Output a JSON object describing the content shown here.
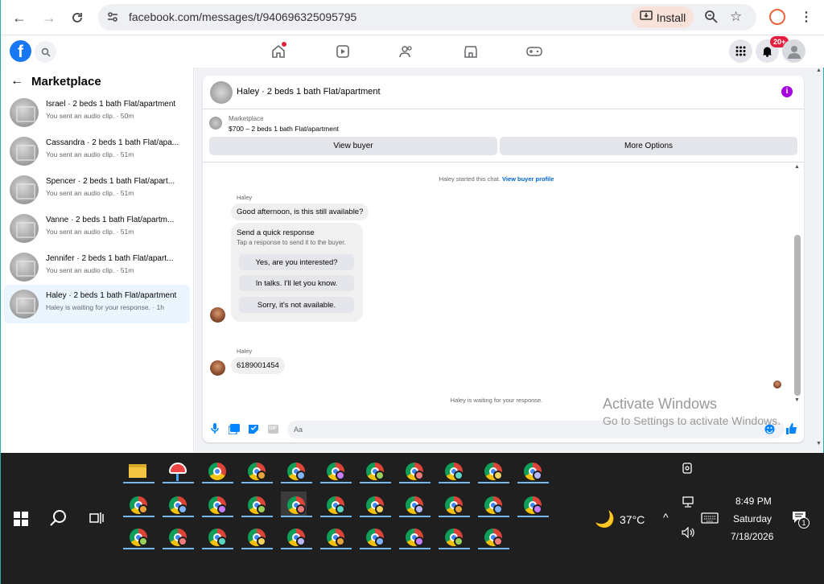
{
  "browser": {
    "url": "facebook.com/messages/t/940696325095795",
    "install_label": "Install"
  },
  "fb": {
    "logo": "f",
    "notification_badge": "20+"
  },
  "sidebar": {
    "title": "Marketplace",
    "conversations": [
      {
        "title": "Israel · 2 beds 1 bath Flat/apartment",
        "sub": "You sent an audio clip. · 50m"
      },
      {
        "title": "Cassandra · 2 beds 1 bath Flat/apa...",
        "sub": "You sent an audio clip. · 51m"
      },
      {
        "title": "Spencer · 2 beds 1 bath Flat/apart...",
        "sub": "You sent an audio clip. · 51m"
      },
      {
        "title": "Vanne · 2 beds 1 bath Flat/apartm...",
        "sub": "You sent an audio clip. · 51m"
      },
      {
        "title": "Jennifer · 2 beds 1 bath Flat/apart...",
        "sub": "You sent an audio clip. · 51m"
      },
      {
        "title": "Haley · 2 beds 1 bath Flat/apartment",
        "sub": "Haley is waiting for your response. · 1h"
      }
    ]
  },
  "chat": {
    "title": "Haley · 2 beds 1 bath Flat/apartment",
    "marketplace_label": "Marketplace",
    "listing": "$700 – 2 beds 1 bath Flat/apartment",
    "view_buyer": "View buyer",
    "more_options": "More Options",
    "started": "Haley started this chat.",
    "view_profile": "View buyer profile",
    "sender": "Haley",
    "msg1": "Good afternoon, is this still available?",
    "quick_title": "Send a quick response",
    "quick_sub": "Tap a response to send it to the buyer.",
    "quick_replies": [
      "Yes, are you interested?",
      "In talks. I'll let you know.",
      "Sorry, it's not available."
    ],
    "msg2": "6189001454",
    "waiting": "Haley is waiting for your response.",
    "composer_placeholder": "Aa"
  },
  "watermark": {
    "line1": "Activate Windows",
    "line2": "Go to Settings to activate Windows."
  },
  "taskbar": {
    "weather": "37°C",
    "time": "8:49 PM",
    "day": "Saturday",
    "date": "7/18/2026",
    "notif_count": "1",
    "profile_colors": [
      "#e8a33d",
      "#7fb3ff",
      "#c77dff",
      "#9ad15b",
      "#f17a7a",
      "#5cd6c4",
      "#f4d35e",
      "#b8b8ff"
    ]
  }
}
